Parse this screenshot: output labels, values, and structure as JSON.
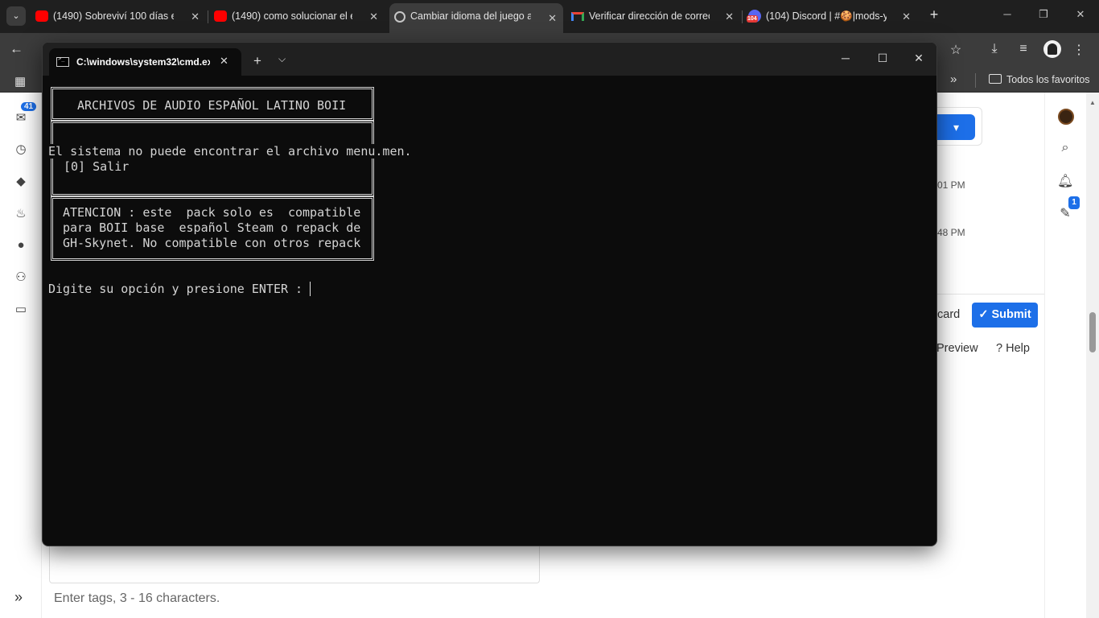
{
  "browser": {
    "tabs": [
      {
        "title": "(1490) Sobreviví 100 días en",
        "icon": "youtube-icon",
        "active": false
      },
      {
        "title": "(1490) como solucionar el er",
        "icon": "youtube-icon",
        "active": false
      },
      {
        "title": "Cambiar idioma del juego a",
        "icon": "site-gear-icon",
        "active": true
      },
      {
        "title": "Verificar dirección de correo",
        "icon": "gmail-icon",
        "active": false
      },
      {
        "title": "(104) Discord | #🍪|mods-y",
        "icon": "discord-icon",
        "active": false
      }
    ],
    "discord_badge": "104",
    "tab_close_glyph": "✕",
    "new_tab_glyph": "+",
    "bookmarks_folder": "Todos los favoritos",
    "colors": {
      "chrome_dark": "#1f1f1f",
      "toolbar": "#3c3c3c",
      "youtube_red": "#ff0000",
      "accent_blue": "#1d6fe8"
    }
  },
  "page": {
    "left_rail_badge": "41",
    "timestamps": [
      "01 PM",
      "48 PM"
    ],
    "discard_label": "card",
    "submit_label": "Submit",
    "preview_label": "Preview",
    "help_label": "Help",
    "right_rail_badge": "1",
    "tags_placeholder": "Enter tags, 3 - 16 characters."
  },
  "terminal": {
    "tab_title": "C:\\windows\\system32\\cmd.ex",
    "console": {
      "header": "ARCHIVOS DE AUDIO ESPAÑOL LATINO BOII",
      "error": "El sistema no puede encontrar el archivo menu.men.",
      "menu_option": "[0] Salir",
      "warning": [
        "ATENCION : este  pack solo es  compatible",
        "para BOII base  español Steam o repack de",
        "GH-Skynet. No compatible con otros repack"
      ],
      "prompt": "Digite su opción y presione ENTER : "
    },
    "colors": {
      "background": "#0c0c0c",
      "text": "#d4d4d4"
    }
  }
}
